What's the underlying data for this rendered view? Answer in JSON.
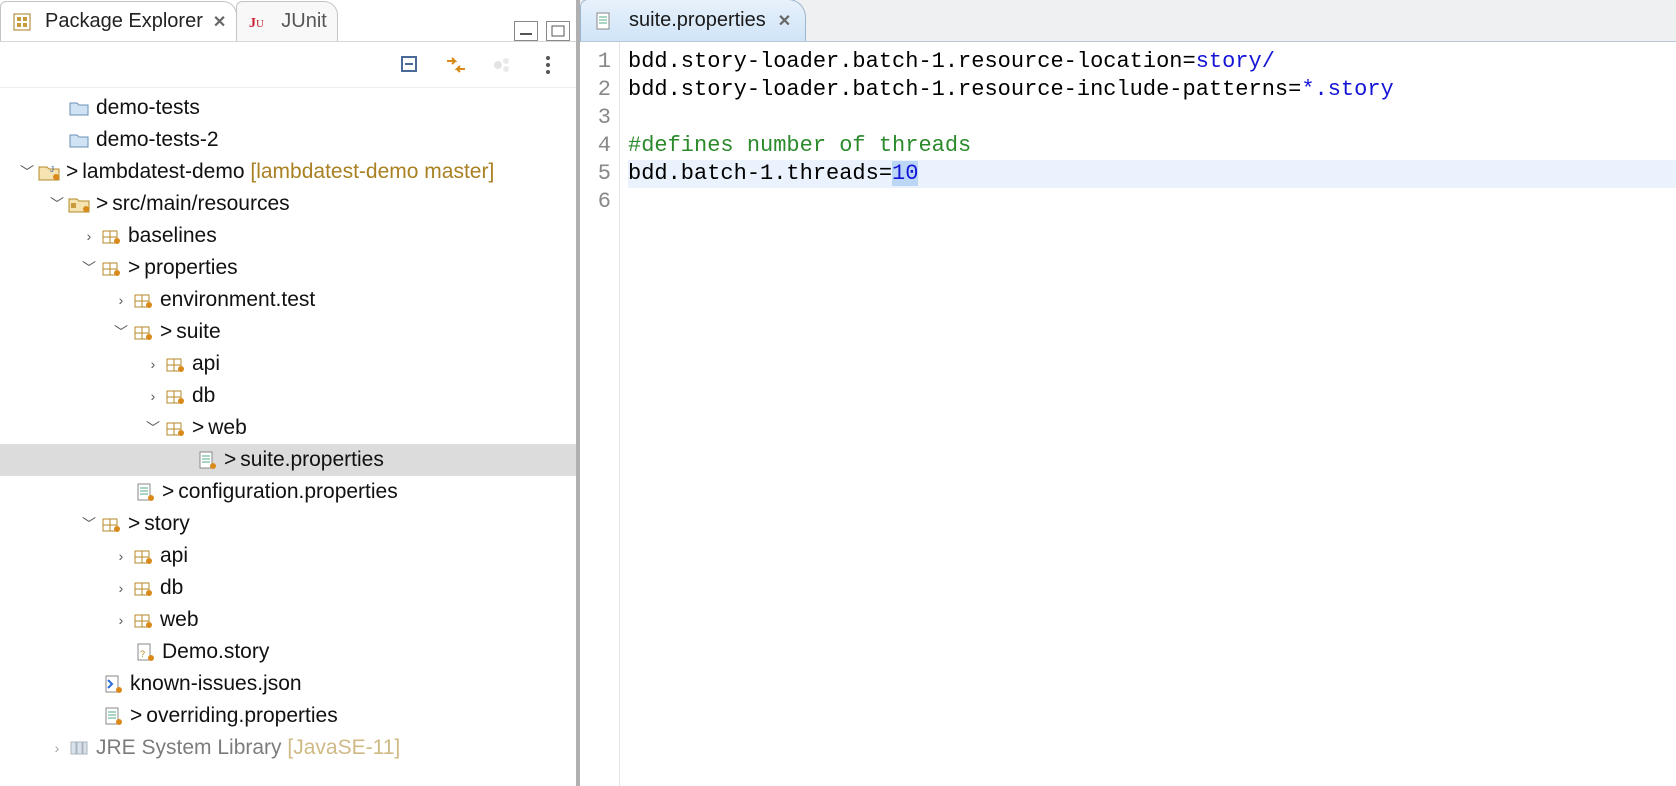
{
  "explorer": {
    "tabs": {
      "package_explorer": "Package Explorer",
      "junit": "JUnit"
    },
    "tree": {
      "demo_tests": "demo-tests",
      "demo_tests_2": "demo-tests-2",
      "lambdatest_demo": "lambdatest-demo",
      "lambdatest_demo_deco": "[lambdatest-demo master]",
      "src_main_resources": "src/main/resources",
      "baselines": "baselines",
      "properties": "properties",
      "environment_test": "environment.test",
      "suite": "suite",
      "api": "api",
      "db": "db",
      "web": "web",
      "suite_properties": "suite.properties",
      "configuration_properties": "configuration.properties",
      "story": "story",
      "story_api": "api",
      "story_db": "db",
      "story_web": "web",
      "demo_story": "Demo.story",
      "known_issues": "known-issues.json",
      "overriding_properties": "overriding.properties",
      "jre_lib": "JRE System Library",
      "jre_lib_deco": "[JavaSE-11]"
    }
  },
  "editor": {
    "tab_title": "suite.properties",
    "lines": {
      "l1_key": "bdd.story-loader.batch-1.resource-location=",
      "l1_val": "story/",
      "l2_key": "bdd.story-loader.batch-1.resource-include-patterns=",
      "l2_val": "*.story",
      "l4_comment": "#defines number of threads",
      "l5_key": "bdd.batch-1.threads=",
      "l5_val": "10"
    },
    "gutter": {
      "n1": "1",
      "n2": "2",
      "n3": "3",
      "n4": "4",
      "n5": "5",
      "n6": "6"
    }
  }
}
